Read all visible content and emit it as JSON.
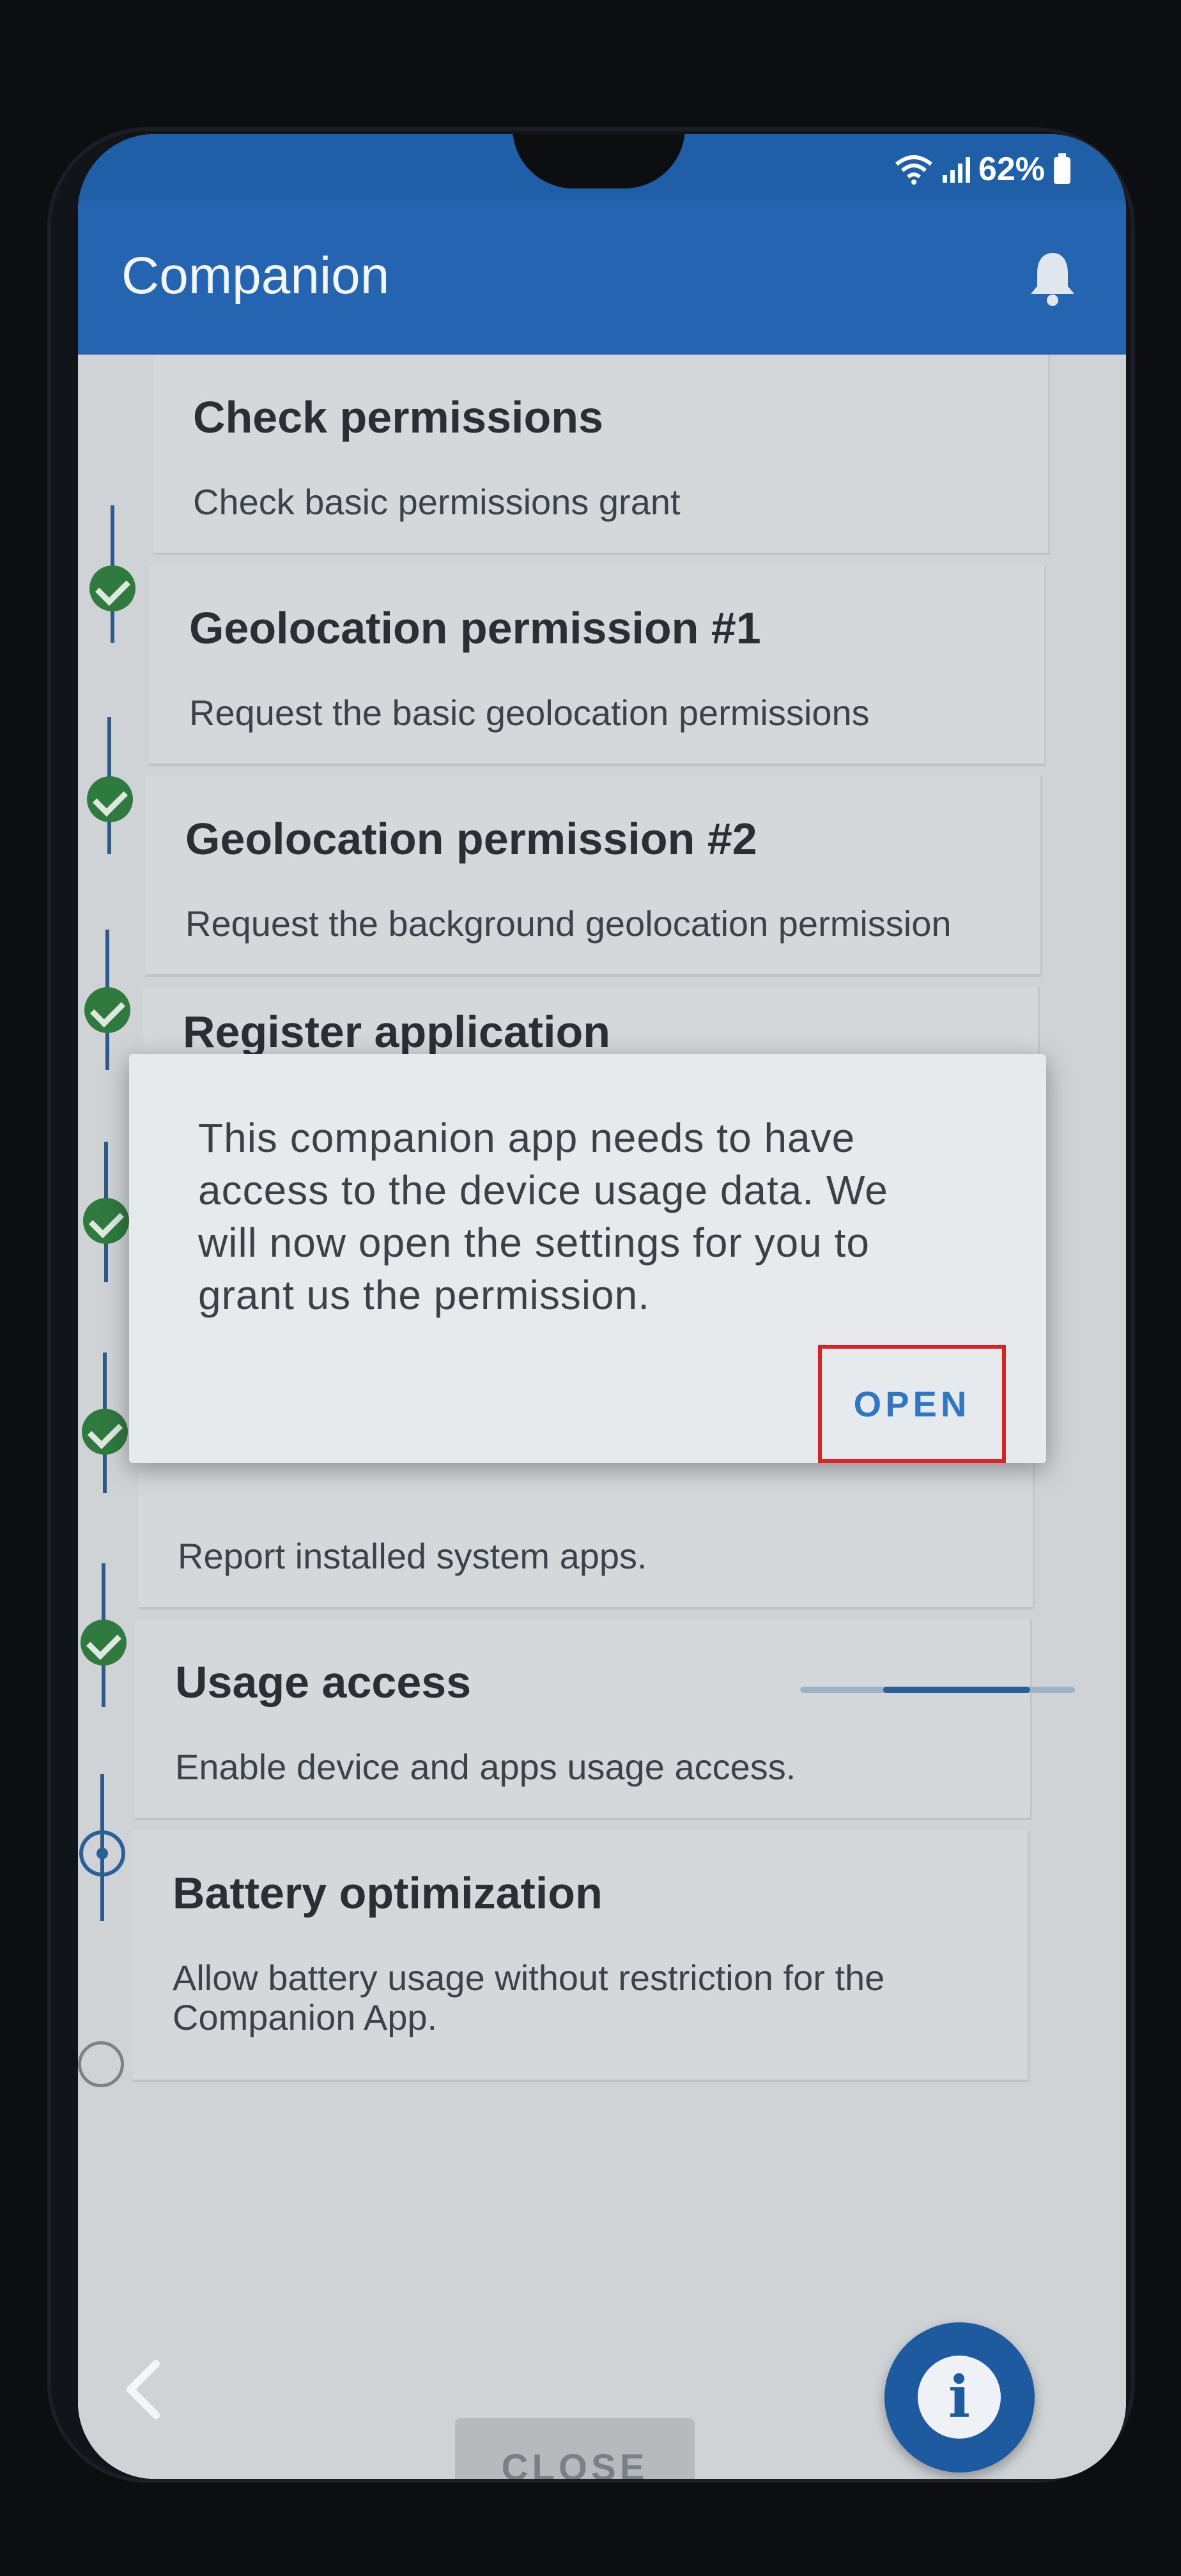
{
  "status_bar": {
    "battery": "62%"
  },
  "app_bar": {
    "title": "Companion"
  },
  "steps": [
    {
      "title": "Check permissions",
      "subtitle": "Check basic permissions grant",
      "state": "done"
    },
    {
      "title": "Geolocation permission #1",
      "subtitle": "Request the basic geolocation permissions",
      "state": "done"
    },
    {
      "title": "Geolocation permission #2",
      "subtitle": "Request the background geolocation permission",
      "state": "done"
    },
    {
      "title": "Register application",
      "subtitle": "",
      "state": "done"
    },
    {
      "title": "",
      "subtitle": "",
      "state": "done"
    },
    {
      "title": "",
      "subtitle": "Report installed system apps.",
      "state": "done"
    },
    {
      "title": "Usage access",
      "subtitle": "Enable device and apps usage access.",
      "state": "current"
    },
    {
      "title": "Battery optimization",
      "subtitle": "Allow battery usage without restriction for the Companion App.",
      "state": "pending"
    }
  ],
  "dialog": {
    "message": "This companion app needs to have access to the device usage data. We will now open the settings for you to grant us the permission.",
    "open_label": "OPEN"
  },
  "footer": {
    "close_label": "CLOSE"
  },
  "colors": {
    "primary": "#2564b0",
    "success": "#2f7a3f",
    "highlight": "#e02020"
  }
}
